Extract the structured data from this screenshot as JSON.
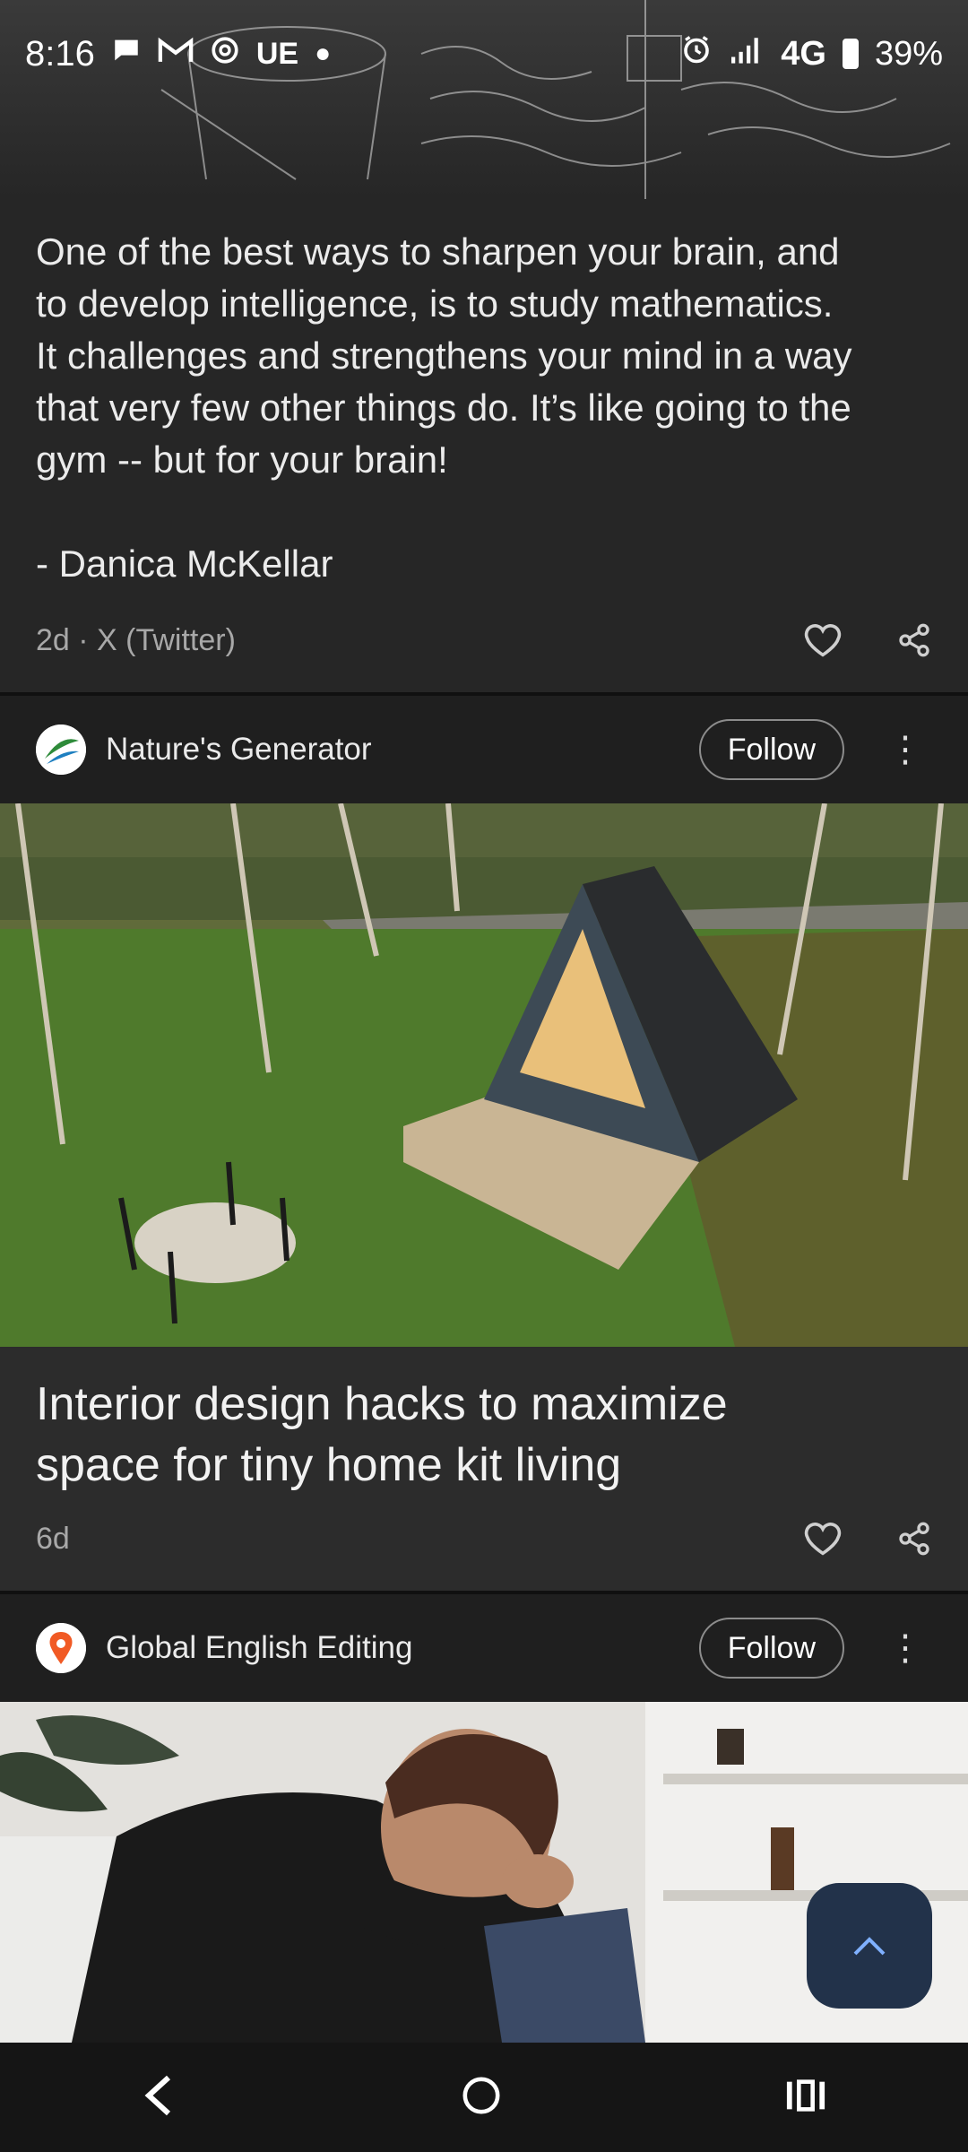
{
  "status_bar": {
    "time": "8:16",
    "carrier_text": "UE",
    "network": "4G",
    "battery": "39%",
    "left_icons": [
      "chat-icon",
      "gmail-icon",
      "threads-icon",
      "dot-icon"
    ],
    "right_icons": [
      "alarm-icon",
      "signal-icon",
      "battery-icon"
    ]
  },
  "quote_card": {
    "text": "One of the best ways to sharpen your brain, and\nto develop intelligence, is to study mathematics.\nIt challenges and strengthens your mind in a way\nthat very few other things do. It’s like going to the\ngym -- but for your brain!\n\n- Danica McKellar",
    "meta": "2d · X (Twitter)"
  },
  "article1": {
    "source_name": "Nature's Generator",
    "follow_label": "Follow",
    "title": "Interior design hacks to maximize\nspace for tiny home kit living",
    "age": "6d"
  },
  "article2": {
    "source_name": "Global English Editing",
    "follow_label": "Follow"
  },
  "colors": {
    "background": "#1f1f1f",
    "card": "#262626",
    "fab": "#22324a"
  }
}
